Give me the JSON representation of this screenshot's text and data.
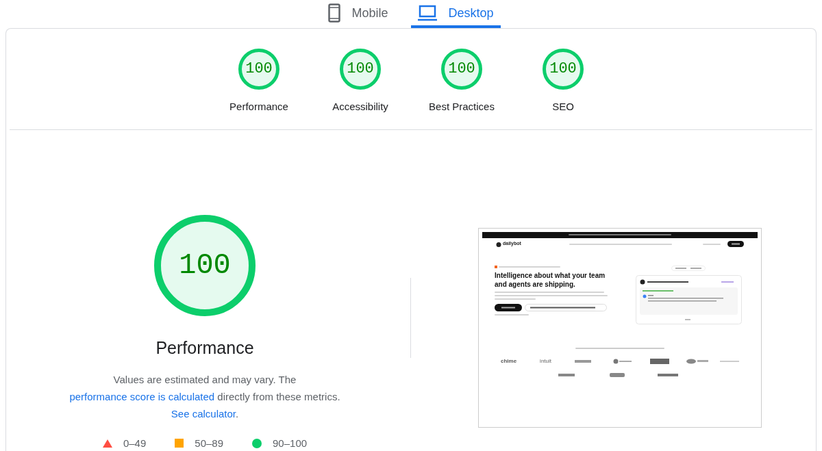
{
  "tabs": [
    {
      "label": "Mobile",
      "kind": "phone",
      "selected": false
    },
    {
      "label": "Desktop",
      "kind": "laptop",
      "selected": true
    }
  ],
  "scores": [
    {
      "value": "100",
      "label": "Performance",
      "level": 1
    },
    {
      "value": "100",
      "label": "Accessibility",
      "level": 1
    },
    {
      "value": "100",
      "label": "Best Practices",
      "level": 1
    },
    {
      "value": "100",
      "label": "SEO",
      "level": 1
    }
  ],
  "main": {
    "value": "100",
    "level": 1,
    "title": "Performance",
    "description": [
      {
        "text": "Values are estimated and may vary. The ",
        "link": false
      },
      {
        "text": "performance score is calculated",
        "link": true
      },
      {
        "text": " directly from these metrics. ",
        "link": false
      },
      {
        "text": "See calculator",
        "link": true
      },
      {
        "text": ".",
        "link": false
      }
    ],
    "legend": [
      {
        "kind": "triangle",
        "range": "0–49",
        "color": "#ff4e42"
      },
      {
        "kind": "square",
        "range": "50–89",
        "color": "#ffa400"
      },
      {
        "kind": "circle",
        "range": "90–100",
        "color": "#0cce6b"
      }
    ]
  },
  "preview": {
    "brand": "dailybot",
    "headline": "Intelligence about what your team and agents are shipping.",
    "logos": [
      "chime",
      "intuit"
    ]
  }
}
